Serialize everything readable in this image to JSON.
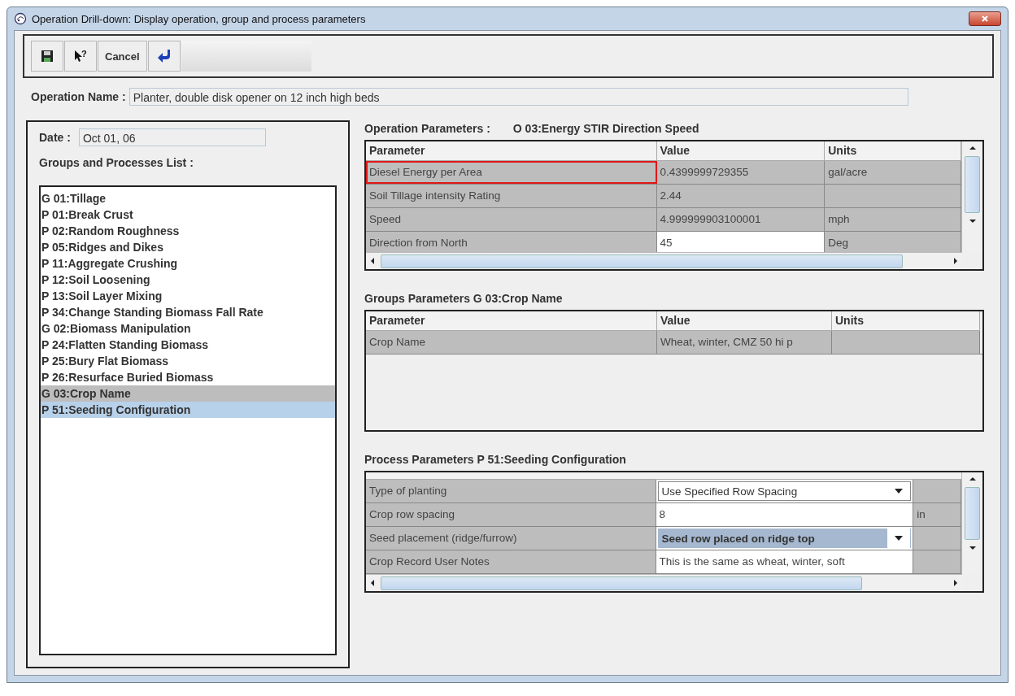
{
  "window": {
    "title": "Operation Drill-down: Display operation, group and process parameters"
  },
  "toolbar": [
    {
      "kind": "save"
    },
    {
      "kind": "help",
      "symbol": "?"
    },
    {
      "kind": "text",
      "label": "Cancel"
    },
    {
      "kind": "return"
    }
  ],
  "operation_name": {
    "label": "Operation Name :",
    "value": "Planter, double disk opener on 12 inch high beds"
  },
  "date": {
    "label": "Date :",
    "value": "Oct 01, 06"
  },
  "groups_list": {
    "label": "Groups and Processes List :",
    "items": [
      {
        "text": "G 01:Tillage",
        "selected": false,
        "highlighted": false
      },
      {
        "text": "P 01:Break Crust",
        "selected": false,
        "highlighted": false
      },
      {
        "text": "P 02:Random Roughness",
        "selected": false,
        "highlighted": false
      },
      {
        "text": "P 05:Ridges and Dikes",
        "selected": false,
        "highlighted": false
      },
      {
        "text": "P 11:Aggregate Crushing",
        "selected": false,
        "highlighted": false
      },
      {
        "text": "P 12:Soil Loosening",
        "selected": false,
        "highlighted": false
      },
      {
        "text": "P 13:Soil Layer Mixing",
        "selected": false,
        "highlighted": false
      },
      {
        "text": "P 34:Change Standing Biomass Fall Rate",
        "selected": false,
        "highlighted": false
      },
      {
        "text": "G 02:Biomass Manipulation",
        "selected": false,
        "highlighted": false
      },
      {
        "text": "P 24:Flatten Standing Biomass",
        "selected": false,
        "highlighted": false
      },
      {
        "text": "P 25:Bury Flat Biomass",
        "selected": false,
        "highlighted": false
      },
      {
        "text": "P 26:Resurface Buried Biomass",
        "selected": false,
        "highlighted": false
      },
      {
        "text": "G 03:Crop Name",
        "selected": false,
        "highlighted": true
      },
      {
        "text": "P 51:Seeding Configuration",
        "selected": true,
        "highlighted": false
      }
    ]
  },
  "operation_parameters": {
    "label": "Operation Parameters :",
    "subtitle": "O 03:Energy STIR Direction Speed",
    "columns": [
      "Parameter",
      "Value",
      "Units"
    ],
    "rows": [
      {
        "focused": true,
        "cells": [
          {
            "kind": "text",
            "text": "Diesel Energy per Area"
          },
          {
            "kind": "text",
            "text": "0.4399999729355"
          },
          {
            "kind": "text",
            "text": "gal/acre"
          }
        ]
      },
      {
        "focused": false,
        "cells": [
          {
            "kind": "text",
            "text": "Soil Tillage intensity Rating"
          },
          {
            "kind": "text",
            "text": "2.44"
          },
          {
            "kind": "text"
          }
        ]
      },
      {
        "focused": false,
        "cells": [
          {
            "kind": "text",
            "text": "Speed"
          },
          {
            "kind": "text",
            "text": "4.999999903100001"
          },
          {
            "kind": "text",
            "text": "mph"
          }
        ]
      },
      {
        "focused": false,
        "cells": [
          {
            "kind": "text",
            "text": "Direction from North"
          },
          {
            "kind": "edit",
            "text": "45"
          },
          {
            "kind": "text",
            "text": "Deg"
          }
        ]
      }
    ]
  },
  "groups_parameters": {
    "label": "Groups Parameters  G 03:Crop Name",
    "columns": [
      "Parameter",
      "Value",
      "Units"
    ],
    "rows": [
      {
        "focused": false,
        "cells": [
          {
            "kind": "text",
            "text": "Crop Name"
          },
          {
            "kind": "text",
            "text": "Wheat, winter, CMZ 50 hi p"
          },
          {
            "kind": "text"
          }
        ]
      }
    ]
  },
  "process_parameters": {
    "label": "Process Parameters  P 51:Seeding Configuration",
    "rows": [
      {
        "focused": false,
        "cells": [
          {
            "kind": "text",
            "text": "Type of planting"
          },
          {
            "kind": "combo",
            "text": "Use Specified Row Spacing"
          },
          {
            "kind": "text"
          }
        ]
      },
      {
        "focused": false,
        "cells": [
          {
            "kind": "text",
            "text": "Crop row spacing"
          },
          {
            "kind": "edit",
            "text": "8"
          },
          {
            "kind": "text",
            "text": "in"
          }
        ]
      },
      {
        "focused": false,
        "cells": [
          {
            "kind": "text",
            "text": "Seed placement (ridge/furrow)"
          },
          {
            "kind": "combo_selected",
            "text": "Seed row placed on ridge top"
          },
          {
            "kind": "text"
          }
        ]
      },
      {
        "focused": false,
        "cells": [
          {
            "kind": "text",
            "text": "Crop Record User Notes"
          },
          {
            "kind": "edit",
            "text": "This is the same as wheat, winter, soft"
          },
          {
            "kind": "text"
          }
        ]
      }
    ]
  }
}
